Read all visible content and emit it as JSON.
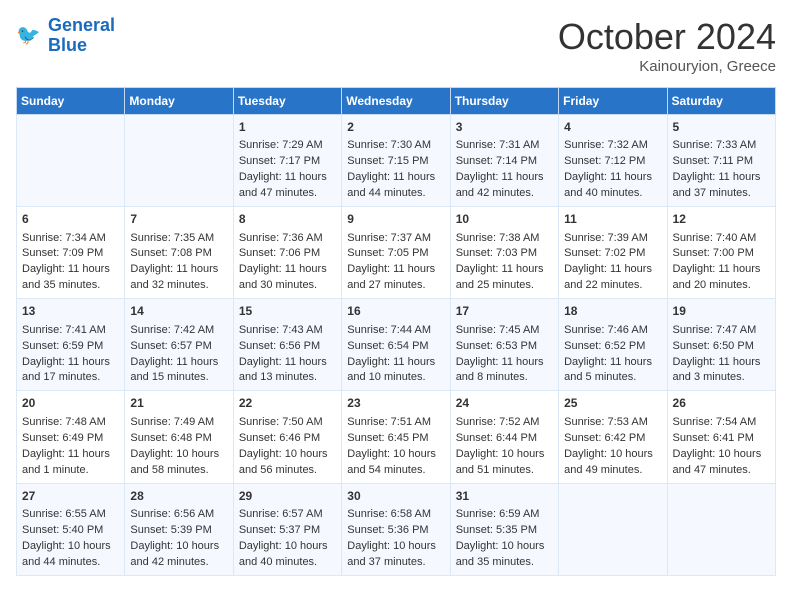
{
  "header": {
    "logo_line1": "General",
    "logo_line2": "Blue",
    "month": "October 2024",
    "location": "Kainouryion, Greece"
  },
  "days_of_week": [
    "Sunday",
    "Monday",
    "Tuesday",
    "Wednesday",
    "Thursday",
    "Friday",
    "Saturday"
  ],
  "weeks": [
    [
      {
        "day": "",
        "sunrise": "",
        "sunset": "",
        "daylight": ""
      },
      {
        "day": "",
        "sunrise": "",
        "sunset": "",
        "daylight": ""
      },
      {
        "day": "1",
        "sunrise": "Sunrise: 7:29 AM",
        "sunset": "Sunset: 7:17 PM",
        "daylight": "Daylight: 11 hours and 47 minutes."
      },
      {
        "day": "2",
        "sunrise": "Sunrise: 7:30 AM",
        "sunset": "Sunset: 7:15 PM",
        "daylight": "Daylight: 11 hours and 44 minutes."
      },
      {
        "day": "3",
        "sunrise": "Sunrise: 7:31 AM",
        "sunset": "Sunset: 7:14 PM",
        "daylight": "Daylight: 11 hours and 42 minutes."
      },
      {
        "day": "4",
        "sunrise": "Sunrise: 7:32 AM",
        "sunset": "Sunset: 7:12 PM",
        "daylight": "Daylight: 11 hours and 40 minutes."
      },
      {
        "day": "5",
        "sunrise": "Sunrise: 7:33 AM",
        "sunset": "Sunset: 7:11 PM",
        "daylight": "Daylight: 11 hours and 37 minutes."
      }
    ],
    [
      {
        "day": "6",
        "sunrise": "Sunrise: 7:34 AM",
        "sunset": "Sunset: 7:09 PM",
        "daylight": "Daylight: 11 hours and 35 minutes."
      },
      {
        "day": "7",
        "sunrise": "Sunrise: 7:35 AM",
        "sunset": "Sunset: 7:08 PM",
        "daylight": "Daylight: 11 hours and 32 minutes."
      },
      {
        "day": "8",
        "sunrise": "Sunrise: 7:36 AM",
        "sunset": "Sunset: 7:06 PM",
        "daylight": "Daylight: 11 hours and 30 minutes."
      },
      {
        "day": "9",
        "sunrise": "Sunrise: 7:37 AM",
        "sunset": "Sunset: 7:05 PM",
        "daylight": "Daylight: 11 hours and 27 minutes."
      },
      {
        "day": "10",
        "sunrise": "Sunrise: 7:38 AM",
        "sunset": "Sunset: 7:03 PM",
        "daylight": "Daylight: 11 hours and 25 minutes."
      },
      {
        "day": "11",
        "sunrise": "Sunrise: 7:39 AM",
        "sunset": "Sunset: 7:02 PM",
        "daylight": "Daylight: 11 hours and 22 minutes."
      },
      {
        "day": "12",
        "sunrise": "Sunrise: 7:40 AM",
        "sunset": "Sunset: 7:00 PM",
        "daylight": "Daylight: 11 hours and 20 minutes."
      }
    ],
    [
      {
        "day": "13",
        "sunrise": "Sunrise: 7:41 AM",
        "sunset": "Sunset: 6:59 PM",
        "daylight": "Daylight: 11 hours and 17 minutes."
      },
      {
        "day": "14",
        "sunrise": "Sunrise: 7:42 AM",
        "sunset": "Sunset: 6:57 PM",
        "daylight": "Daylight: 11 hours and 15 minutes."
      },
      {
        "day": "15",
        "sunrise": "Sunrise: 7:43 AM",
        "sunset": "Sunset: 6:56 PM",
        "daylight": "Daylight: 11 hours and 13 minutes."
      },
      {
        "day": "16",
        "sunrise": "Sunrise: 7:44 AM",
        "sunset": "Sunset: 6:54 PM",
        "daylight": "Daylight: 11 hours and 10 minutes."
      },
      {
        "day": "17",
        "sunrise": "Sunrise: 7:45 AM",
        "sunset": "Sunset: 6:53 PM",
        "daylight": "Daylight: 11 hours and 8 minutes."
      },
      {
        "day": "18",
        "sunrise": "Sunrise: 7:46 AM",
        "sunset": "Sunset: 6:52 PM",
        "daylight": "Daylight: 11 hours and 5 minutes."
      },
      {
        "day": "19",
        "sunrise": "Sunrise: 7:47 AM",
        "sunset": "Sunset: 6:50 PM",
        "daylight": "Daylight: 11 hours and 3 minutes."
      }
    ],
    [
      {
        "day": "20",
        "sunrise": "Sunrise: 7:48 AM",
        "sunset": "Sunset: 6:49 PM",
        "daylight": "Daylight: 11 hours and 1 minute."
      },
      {
        "day": "21",
        "sunrise": "Sunrise: 7:49 AM",
        "sunset": "Sunset: 6:48 PM",
        "daylight": "Daylight: 10 hours and 58 minutes."
      },
      {
        "day": "22",
        "sunrise": "Sunrise: 7:50 AM",
        "sunset": "Sunset: 6:46 PM",
        "daylight": "Daylight: 10 hours and 56 minutes."
      },
      {
        "day": "23",
        "sunrise": "Sunrise: 7:51 AM",
        "sunset": "Sunset: 6:45 PM",
        "daylight": "Daylight: 10 hours and 54 minutes."
      },
      {
        "day": "24",
        "sunrise": "Sunrise: 7:52 AM",
        "sunset": "Sunset: 6:44 PM",
        "daylight": "Daylight: 10 hours and 51 minutes."
      },
      {
        "day": "25",
        "sunrise": "Sunrise: 7:53 AM",
        "sunset": "Sunset: 6:42 PM",
        "daylight": "Daylight: 10 hours and 49 minutes."
      },
      {
        "day": "26",
        "sunrise": "Sunrise: 7:54 AM",
        "sunset": "Sunset: 6:41 PM",
        "daylight": "Daylight: 10 hours and 47 minutes."
      }
    ],
    [
      {
        "day": "27",
        "sunrise": "Sunrise: 6:55 AM",
        "sunset": "Sunset: 5:40 PM",
        "daylight": "Daylight: 10 hours and 44 minutes."
      },
      {
        "day": "28",
        "sunrise": "Sunrise: 6:56 AM",
        "sunset": "Sunset: 5:39 PM",
        "daylight": "Daylight: 10 hours and 42 minutes."
      },
      {
        "day": "29",
        "sunrise": "Sunrise: 6:57 AM",
        "sunset": "Sunset: 5:37 PM",
        "daylight": "Daylight: 10 hours and 40 minutes."
      },
      {
        "day": "30",
        "sunrise": "Sunrise: 6:58 AM",
        "sunset": "Sunset: 5:36 PM",
        "daylight": "Daylight: 10 hours and 37 minutes."
      },
      {
        "day": "31",
        "sunrise": "Sunrise: 6:59 AM",
        "sunset": "Sunset: 5:35 PM",
        "daylight": "Daylight: 10 hours and 35 minutes."
      },
      {
        "day": "",
        "sunrise": "",
        "sunset": "",
        "daylight": ""
      },
      {
        "day": "",
        "sunrise": "",
        "sunset": "",
        "daylight": ""
      }
    ]
  ]
}
